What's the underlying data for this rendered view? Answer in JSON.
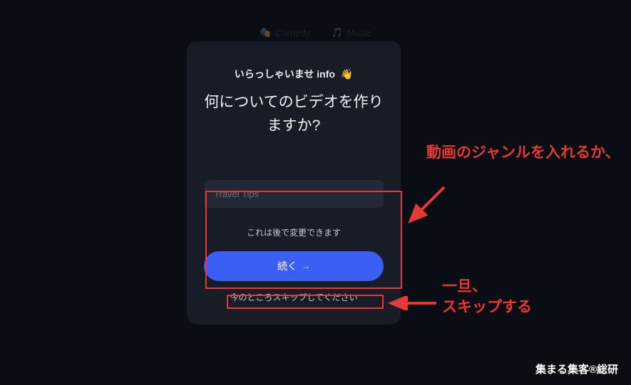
{
  "background_tags": {
    "comedy": "Comedy",
    "music": "Music"
  },
  "modal": {
    "welcome_prefix": "いらっしゃいませ",
    "welcome_name": "info",
    "wave_emoji": "👋",
    "question": "何についてのビデオを作りますか?",
    "input_placeholder": "Travel Tips",
    "note": "これは後で変更できます",
    "continue_label": "続く",
    "continue_arrow": "→",
    "skip_label": "今のところスキップしてください"
  },
  "annotations": {
    "genre": "動画のジャンルを入れるか、",
    "skip": "一旦、\nスキップする"
  },
  "watermark": "集まる集客®総研",
  "colors": {
    "highlight": "#e53935",
    "primary_button": "#3b5ff5",
    "modal_bg": "#181c27"
  }
}
